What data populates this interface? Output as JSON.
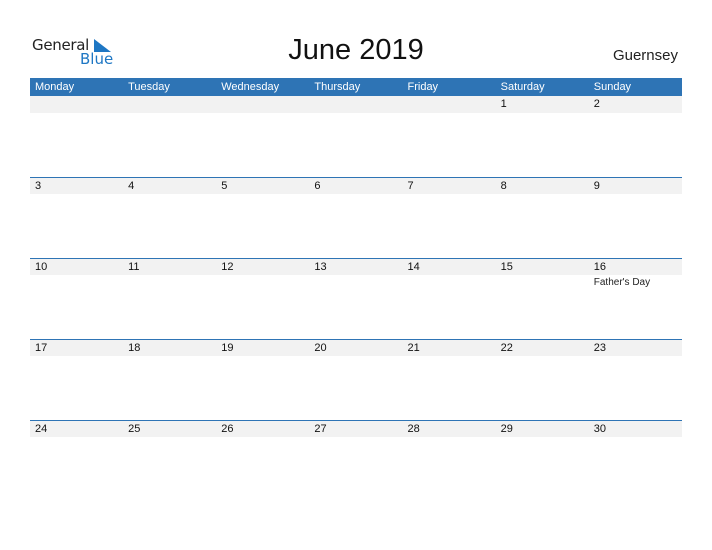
{
  "logo": {
    "general": "General",
    "blue": "Blue"
  },
  "title": "June 2019",
  "country": "Guernsey",
  "weekdays": [
    "Monday",
    "Tuesday",
    "Wednesday",
    "Thursday",
    "Friday",
    "Saturday",
    "Sunday"
  ],
  "weeks": [
    {
      "days": [
        "",
        "",
        "",
        "",
        "",
        "1",
        "2"
      ],
      "events": [
        "",
        "",
        "",
        "",
        "",
        "",
        ""
      ]
    },
    {
      "days": [
        "3",
        "4",
        "5",
        "6",
        "7",
        "8",
        "9"
      ],
      "events": [
        "",
        "",
        "",
        "",
        "",
        "",
        ""
      ]
    },
    {
      "days": [
        "10",
        "11",
        "12",
        "13",
        "14",
        "15",
        "16"
      ],
      "events": [
        "",
        "",
        "",
        "",
        "",
        "",
        "Father's Day"
      ]
    },
    {
      "days": [
        "17",
        "18",
        "19",
        "20",
        "21",
        "22",
        "23"
      ],
      "events": [
        "",
        "",
        "",
        "",
        "",
        "",
        ""
      ]
    },
    {
      "days": [
        "24",
        "25",
        "26",
        "27",
        "28",
        "29",
        "30"
      ],
      "events": [
        "",
        "",
        "",
        "",
        "",
        "",
        ""
      ]
    }
  ]
}
